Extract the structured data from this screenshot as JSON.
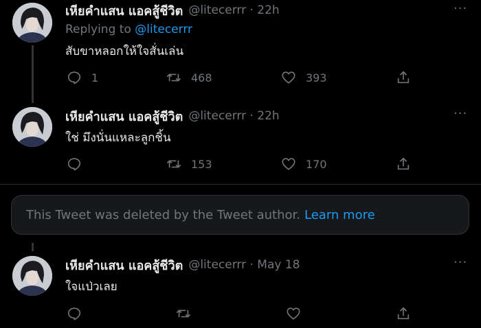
{
  "tweets": [
    {
      "display_name": "เหียคำแสน แอคสู้ชีวิต",
      "handle_time": "@litecerrr · 22h",
      "replying_prefix": "Replying to",
      "replying_handle": "@litecerrr",
      "text": "สับขาหลอกให้ใจสั่นเล่น",
      "replies": "1",
      "retweets": "468",
      "likes": "393"
    },
    {
      "display_name": "เหียคำแสน แอคสู้ชีวิต",
      "handle_time": "@litecerrr · 22h",
      "text": "ใช่ มึงนั่นแหละลูกชิ้น",
      "replies": "",
      "retweets": "153",
      "likes": "170"
    },
    {
      "display_name": "เหียคำแสน แอคสู้ชีวิต",
      "handle_time": "@litecerrr · May 18",
      "text": "ใจแป่วเลย",
      "replies": "",
      "retweets": "",
      "likes": ""
    }
  ],
  "deleted_notice": {
    "text": "This Tweet was deleted by the Tweet author.",
    "link": "Learn more"
  },
  "more_glyph": "···",
  "colors": {
    "background": "#000000",
    "text": "#e7e9ea",
    "muted": "#71767b",
    "accent": "#1d9bf0",
    "border": "#2f3336"
  },
  "icons": [
    "reply-icon",
    "retweet-icon",
    "like-icon",
    "share-icon",
    "more-icon"
  ]
}
